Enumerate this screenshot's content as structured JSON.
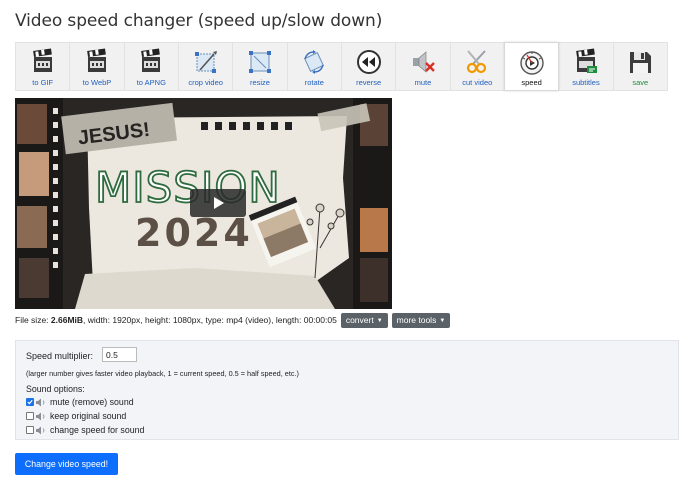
{
  "page": {
    "title": "Video speed changer (speed up/slow down)"
  },
  "toolbar": {
    "items": [
      {
        "label": "to GIF",
        "icon": "clapperboard-icon"
      },
      {
        "label": "to WebP",
        "icon": "clapperboard-icon"
      },
      {
        "label": "to APNG",
        "icon": "clapperboard-icon"
      },
      {
        "label": "crop video",
        "icon": "crop-icon"
      },
      {
        "label": "resize",
        "icon": "resize-icon"
      },
      {
        "label": "rotate",
        "icon": "rotate-icon"
      },
      {
        "label": "reverse",
        "icon": "reverse-icon"
      },
      {
        "label": "mute",
        "icon": "mute-speaker-icon"
      },
      {
        "label": "cut video",
        "icon": "scissors-icon"
      },
      {
        "label": "speed",
        "icon": "speedometer-icon"
      },
      {
        "label": "subtitles",
        "icon": "subtitles-icon"
      },
      {
        "label": "save",
        "icon": "floppy-disk-icon"
      }
    ],
    "active": "speed"
  },
  "video": {
    "banner_text": "JESUS!",
    "headline": "MISSION",
    "year": "2024"
  },
  "file_info": {
    "size_label": "File size:",
    "size_value": "2.66MiB",
    "details": ", width: 1920px, height: 1080px, type: mp4 (video), length: 00:00:05",
    "convert_label": "convert",
    "more_tools_label": "more tools"
  },
  "form": {
    "speed_label": "Speed multiplier:",
    "speed_value": "0.5",
    "hint": "(larger number gives faster video playback, 1 = current speed, 0.5 = half speed, etc.)",
    "sound_title": "Sound options:",
    "sound_options": [
      {
        "label": "mute (remove) sound",
        "checked": true
      },
      {
        "label": "keep original sound",
        "checked": false
      },
      {
        "label": "change speed for sound",
        "checked": false
      }
    ],
    "submit_label": "Change video speed!"
  },
  "colors": {
    "primary": "#0d6efd",
    "tool_label": "#1f5fbf",
    "save_label": "#1f8a3b",
    "dropdown_button": "#5a6268",
    "headline_green": "#2e6b3e"
  }
}
